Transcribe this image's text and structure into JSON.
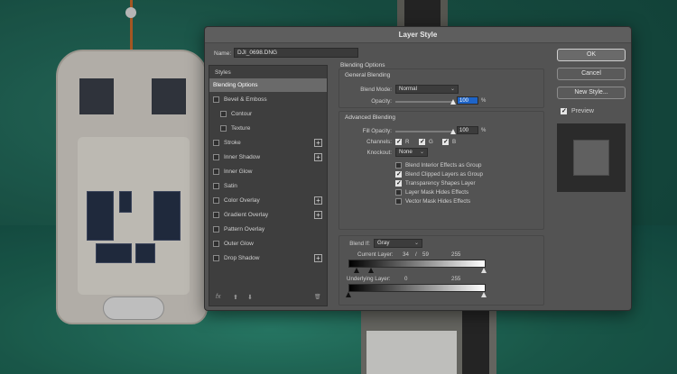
{
  "dialog": {
    "title": "Layer Style",
    "name_label": "Name:",
    "name_value": "DJI_0698.DNG"
  },
  "styles": {
    "header": "Styles",
    "items": [
      {
        "label": "Blending Options",
        "checkbox": false,
        "plus": false,
        "selected": true,
        "indent": false
      },
      {
        "label": "Bevel & Emboss",
        "checkbox": true,
        "plus": false,
        "selected": false,
        "indent": false
      },
      {
        "label": "Contour",
        "checkbox": true,
        "plus": false,
        "selected": false,
        "indent": true
      },
      {
        "label": "Texture",
        "checkbox": true,
        "plus": false,
        "selected": false,
        "indent": true
      },
      {
        "label": "Stroke",
        "checkbox": true,
        "plus": true,
        "selected": false,
        "indent": false
      },
      {
        "label": "Inner Shadow",
        "checkbox": true,
        "plus": true,
        "selected": false,
        "indent": false
      },
      {
        "label": "Inner Glow",
        "checkbox": true,
        "plus": false,
        "selected": false,
        "indent": false
      },
      {
        "label": "Satin",
        "checkbox": true,
        "plus": false,
        "selected": false,
        "indent": false
      },
      {
        "label": "Color Overlay",
        "checkbox": true,
        "plus": true,
        "selected": false,
        "indent": false
      },
      {
        "label": "Gradient Overlay",
        "checkbox": true,
        "plus": true,
        "selected": false,
        "indent": false
      },
      {
        "label": "Pattern Overlay",
        "checkbox": true,
        "plus": false,
        "selected": false,
        "indent": false
      },
      {
        "label": "Outer Glow",
        "checkbox": true,
        "plus": false,
        "selected": false,
        "indent": false
      },
      {
        "label": "Drop Shadow",
        "checkbox": true,
        "plus": true,
        "selected": false,
        "indent": false
      }
    ],
    "fx_label": "fx",
    "up_label": "⬆",
    "down_label": "⬇",
    "trash_label": "🗑"
  },
  "blending": {
    "title": "Blending Options",
    "general_title": "General Blending",
    "blend_mode_label": "Blend Mode:",
    "blend_mode_value": "Normal",
    "opacity_label": "Opacity:",
    "opacity_value": "100",
    "opacity_unit": "%",
    "advanced_title": "Advanced Blending",
    "fill_opacity_label": "Fill Opacity:",
    "fill_opacity_value": "100",
    "fill_opacity_unit": "%",
    "channels_label": "Channels:",
    "channels": [
      {
        "label": "R",
        "checked": true
      },
      {
        "label": "G",
        "checked": true
      },
      {
        "label": "B",
        "checked": true
      }
    ],
    "knockout_label": "Knockout:",
    "knockout_value": "None",
    "options": [
      {
        "label": "Blend Interior Effects as Group",
        "checked": false
      },
      {
        "label": "Blend Clipped Layers as Group",
        "checked": true
      },
      {
        "label": "Transparency Shapes Layer",
        "checked": true
      },
      {
        "label": "Layer Mask Hides Effects",
        "checked": false
      },
      {
        "label": "Vector Mask Hides Effects",
        "checked": false
      }
    ],
    "blend_if_label": "Blend If:",
    "blend_if_value": "Gray",
    "current_layer_label": "Current Layer:",
    "current_low": "34",
    "current_sep": "/",
    "current_split": "59",
    "current_high": "255",
    "underlying_label": "Underlying Layer:",
    "underlying_low": "0",
    "underlying_high": "255"
  },
  "buttons": {
    "ok": "OK",
    "cancel": "Cancel",
    "new_style": "New Style...",
    "preview_label": "Preview",
    "preview_checked": true
  }
}
